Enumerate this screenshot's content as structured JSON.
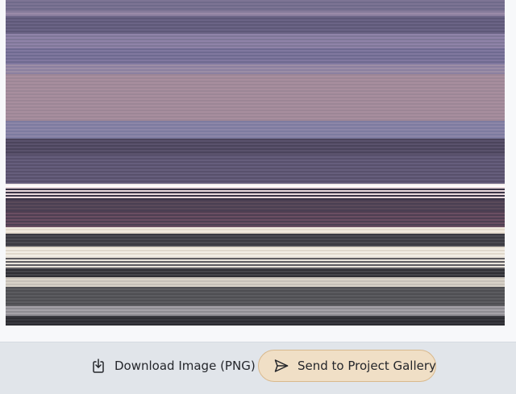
{
  "actions": {
    "download_label": "Download Image (PNG)",
    "download_icon": "download-icon",
    "send_label": "Send to Project Gallery",
    "send_icon": "send-icon"
  },
  "colors": {
    "send_button_bg": "#f0dfc6",
    "send_button_border": "#d9b98d",
    "action_bar_bg": "#e1e5ea"
  }
}
